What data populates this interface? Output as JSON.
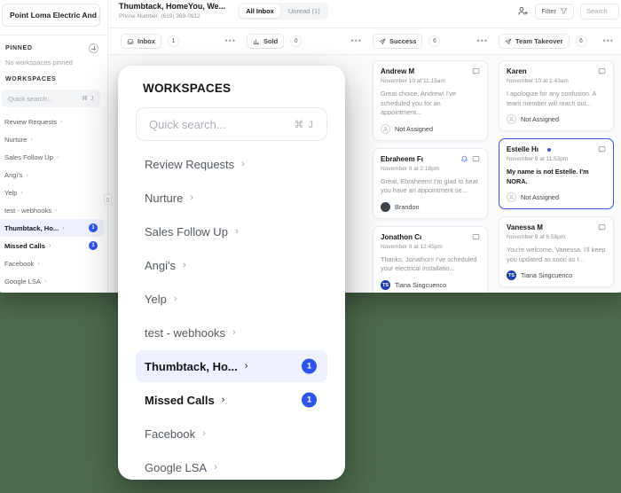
{
  "sidebar": {
    "workspace_switcher": "Point Loma Electric And ...",
    "pinned_title": "PINNED",
    "pinned_empty": "No workspaces pinned",
    "workspaces_title": "WORKSPACES",
    "search_placeholder": "Quick search...",
    "search_shortcut": "⌘ J",
    "items": [
      {
        "label": "Review Requests",
        "badge": "",
        "bold": false,
        "selected": false
      },
      {
        "label": "Nurture",
        "badge": "",
        "bold": false,
        "selected": false
      },
      {
        "label": "Sales Follow Up",
        "badge": "",
        "bold": false,
        "selected": false
      },
      {
        "label": "Angi's",
        "badge": "",
        "bold": false,
        "selected": false
      },
      {
        "label": "Yelp",
        "badge": "",
        "bold": false,
        "selected": false
      },
      {
        "label": "test - webhooks",
        "badge": "",
        "bold": false,
        "selected": false
      },
      {
        "label": "Thumbtack, Ho...",
        "badge": "1",
        "bold": true,
        "selected": true
      },
      {
        "label": "Missed Calls",
        "badge": "1",
        "bold": true,
        "selected": false
      },
      {
        "label": "Facebook",
        "badge": "",
        "bold": false,
        "selected": false
      },
      {
        "label": "Google LSA",
        "badge": "",
        "bold": false,
        "selected": false
      }
    ]
  },
  "topbar": {
    "title": "Thumbtack, HomeYou, We...",
    "subtitle": "Phone Number: (619) 369-0912",
    "tabs": [
      {
        "label": "All Inbox",
        "active": true
      },
      {
        "label": "Unread (1)",
        "active": false
      }
    ],
    "add_user_icon": "add-user-icon",
    "filter_label": "Filter",
    "search_placeholder": "Search"
  },
  "columns": [
    {
      "name": "Inbox",
      "icon": "inbox-icon",
      "count": "1"
    },
    {
      "name": "Sold",
      "icon": "bar-chart-icon",
      "count": "0"
    },
    {
      "name": "Success",
      "icon": "send-icon",
      "count": "6"
    },
    {
      "name": "Team Takeover",
      "icon": "send-icon",
      "count": "6"
    }
  ],
  "cards": {
    "success": [
      {
        "name": "Andrew M",
        "date": "November 10 at 11:15am",
        "message": "Great choice, Andrew! I've scheduled you for an appointment...",
        "assignee": "Not Assigned",
        "avatar": "empty",
        "unread": false,
        "active": false,
        "dot": false,
        "bell": false
      },
      {
        "name": "Ebraheem Fı",
        "date": "November 9 at 2:18pm",
        "message": "Great, Ebraheem! I'm glad to hear you have an appointment se...",
        "assignee": "Brandon",
        "avatar": "dark",
        "unread": false,
        "active": false,
        "dot": false,
        "bell": true
      },
      {
        "name": "Jonathon Cı",
        "date": "November 9 at 12:45pm",
        "message": "Thanks, Jonathon! I've scheduled your electrical installatio...",
        "assignee": "Tiana Singcuenco",
        "avatar": "blue",
        "avatar_initials": "TS",
        "unread": false,
        "active": false,
        "dot": false,
        "bell": false
      }
    ],
    "team_takeover": [
      {
        "name": "Karen",
        "date": "November 10 at 1:43am",
        "message": "I apologize for any confusion. A team member will reach out...",
        "assignee": "Not Assigned",
        "avatar": "empty",
        "unread": false,
        "active": false,
        "dot": false,
        "bell": false
      },
      {
        "name": "Estelle Hı",
        "date": "November 9 at 11:53pm",
        "message": "My name is not Estelle. I'm NORA.",
        "assignee": "Not Assigned",
        "avatar": "empty",
        "unread": true,
        "active": true,
        "dot": true,
        "bell": false
      },
      {
        "name": "Vanessa M",
        "date": "November 9 at 6:58pm",
        "message": "You're welcome, Vanessa. I'll keep you updated as soon as I...",
        "assignee": "Tiana Singcuenco",
        "avatar": "blue",
        "avatar_initials": "TS",
        "unread": false,
        "active": false,
        "dot": false,
        "bell": false
      }
    ]
  },
  "modal": {
    "title": "WORKSPACES",
    "search_placeholder": "Quick search...",
    "search_shortcut": "⌘ J",
    "items": [
      {
        "label": "Review Requests",
        "badge": "",
        "bold": false,
        "selected": false
      },
      {
        "label": "Nurture",
        "badge": "",
        "bold": false,
        "selected": false
      },
      {
        "label": "Sales Follow Up",
        "badge": "",
        "bold": false,
        "selected": false
      },
      {
        "label": "Angi's",
        "badge": "",
        "bold": false,
        "selected": false
      },
      {
        "label": "Yelp",
        "badge": "",
        "bold": false,
        "selected": false
      },
      {
        "label": "test - webhooks",
        "badge": "",
        "bold": false,
        "selected": false
      },
      {
        "label": "Thumbtack, Ho...",
        "badge": "1",
        "bold": true,
        "selected": true
      },
      {
        "label": "Missed Calls",
        "badge": "1",
        "bold": true,
        "selected": false
      },
      {
        "label": "Facebook",
        "badge": "",
        "bold": false,
        "selected": false
      },
      {
        "label": "Google LSA",
        "badge": "",
        "bold": false,
        "selected": false
      }
    ]
  },
  "colors": {
    "background": "#4d6b4d",
    "accent": "#2f54eb",
    "selected_row": "#eef1fd"
  }
}
